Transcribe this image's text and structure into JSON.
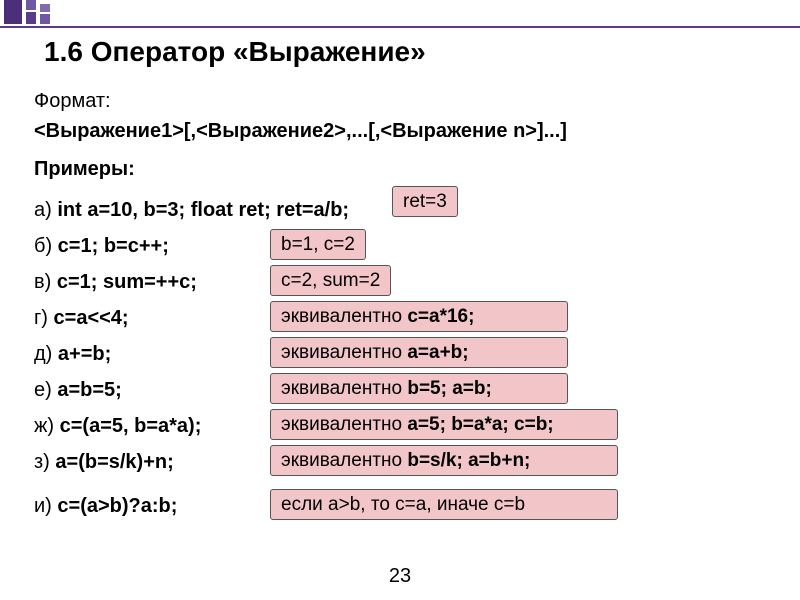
{
  "title": "1.6 Оператор «Выражение»",
  "format_label": "Формат:",
  "format_syntax": "<Выражение1>[,<Выражение2>,...[,<Выражение n>]...]",
  "examples_label": "Примеры:",
  "examples": [
    {
      "prefix": "а) ",
      "code": "int  a=10, b=3; float ret; ret=a/b;",
      "result": "ret=3"
    },
    {
      "prefix": "б) ",
      "code": "с=1;   b=c++;",
      "result": "b=1,  c=2"
    },
    {
      "prefix": "в) ",
      "code": "c=1;    sum=++c;",
      "result": "c=2, sum=2"
    },
    {
      "prefix": "г) ",
      "code": "c=a<<4;",
      "result_prefix": "эквивалентно ",
      "result_bold": "c=a*16;"
    },
    {
      "prefix": "д) ",
      "code": "a+=b;",
      "result_prefix": "эквивалентно ",
      "result_bold": "a=a+b;"
    },
    {
      "prefix": "е) ",
      "code": "a=b=5;",
      "result_prefix": "эквивалентно ",
      "result_bold": "b=5; a=b;"
    },
    {
      "prefix": "ж) ",
      "code": "c=(a=5, b=a*a);",
      "result_prefix": "эквивалентно ",
      "result_bold": "a=5; b=a*a; c=b;"
    },
    {
      "prefix": "з) ",
      "code": "a=(b=s/k)+n;",
      "result_prefix": "эквивалентно ",
      "result_bold": "b=s/k; a=b+n;"
    },
    {
      "prefix": "и) ",
      "code": "c=(a>b)?a:b;",
      "result": "если a>b, то c=a, иначе c=b"
    }
  ],
  "page_number": "23"
}
